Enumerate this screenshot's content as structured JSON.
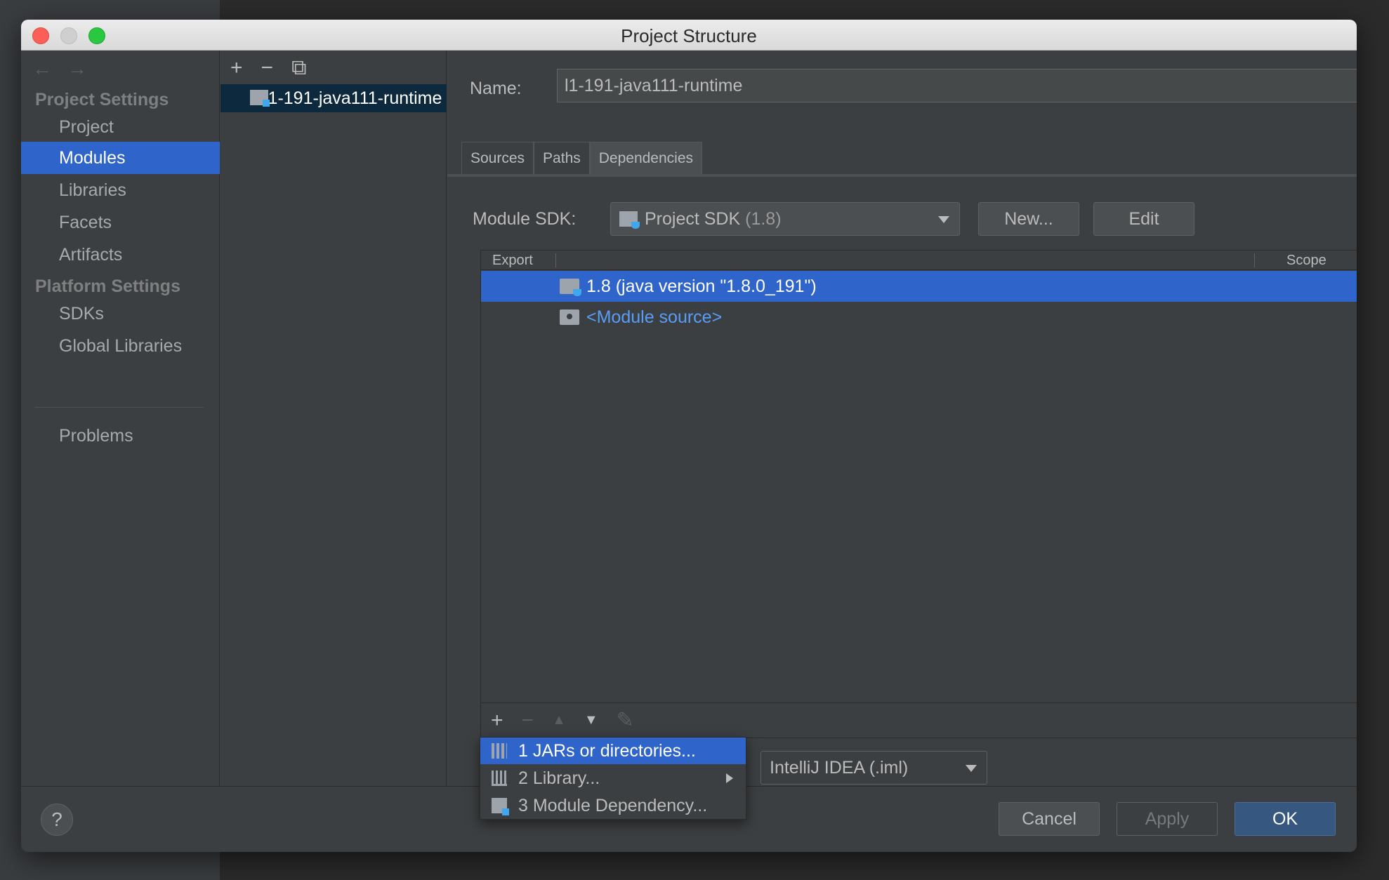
{
  "window": {
    "title": "Project Structure"
  },
  "nav": {
    "back_icon": "←",
    "forward_icon": "→"
  },
  "sidebar": {
    "project_settings_header": "Project Settings",
    "project_items": [
      {
        "label": "Project"
      },
      {
        "label": "Modules",
        "active": true
      },
      {
        "label": "Libraries"
      },
      {
        "label": "Facets"
      },
      {
        "label": "Artifacts"
      }
    ],
    "platform_settings_header": "Platform Settings",
    "platform_items": [
      {
        "label": "SDKs"
      },
      {
        "label": "Global Libraries"
      }
    ],
    "problems_label": "Problems"
  },
  "modules_pane": {
    "add_icon": "+",
    "remove_icon": "−",
    "copy_icon": "⧉",
    "selected_module": "l1-191-java111-runtime"
  },
  "main": {
    "name_label": "Name:",
    "name_value": "l1-191-java111-runtime",
    "tabs": [
      {
        "label": "Sources"
      },
      {
        "label": "Paths"
      },
      {
        "label": "Dependencies",
        "selected": true
      }
    ],
    "sdk_label": "Module SDK:",
    "sdk_value": "Project SDK",
    "sdk_version": "(1.8)",
    "new_button": "New...",
    "edit_button": "Edit"
  },
  "dependencies_table": {
    "columns": {
      "export": "Export",
      "scope": "Scope"
    },
    "rows": [
      {
        "label": "1.8 (java version \"1.8.0_191\")",
        "selected": true
      },
      {
        "label": "<Module source>",
        "link": true
      }
    ],
    "toolbar": {
      "add": "+",
      "remove": "−",
      "up": "▲",
      "down": "▼",
      "edit": "✎"
    }
  },
  "add_popup": {
    "items": [
      {
        "label": "1  JARs or directories...",
        "icon": "jar-icon",
        "selected": true
      },
      {
        "label": "2  Library...",
        "icon": "library-icon",
        "submenu": true
      },
      {
        "label": "3  Module Dependency...",
        "icon": "module-icon"
      }
    ]
  },
  "storage_format": {
    "value": "IntelliJ IDEA (.iml)"
  },
  "footer": {
    "help": "?",
    "cancel": "Cancel",
    "apply": "Apply",
    "ok": "OK"
  },
  "colors": {
    "accent": "#2f65ca",
    "primary_button": "#365880",
    "link": "#589df6",
    "background": "#3c3f41"
  }
}
